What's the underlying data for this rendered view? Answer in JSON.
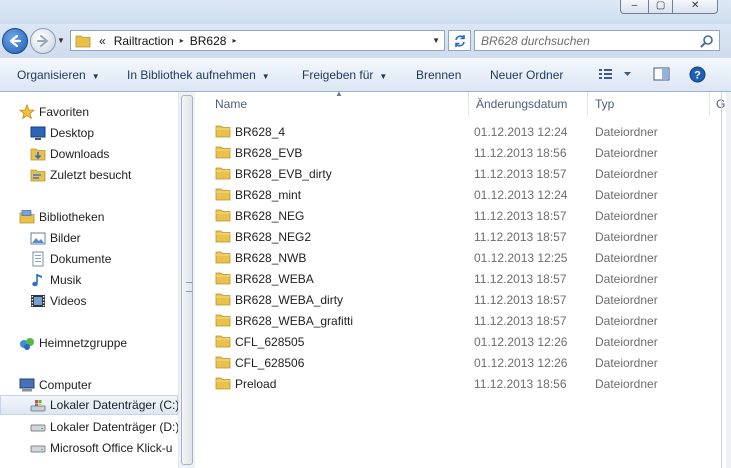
{
  "window": {
    "min_icon": "minimize-icon",
    "max_icon": "maximize-icon",
    "close_icon": "close-icon",
    "max_glyph": "▢",
    "close_glyph": "✕"
  },
  "address": {
    "prefix": "«",
    "crumbs": [
      "Railtraction",
      "BR628"
    ],
    "separator": "▸",
    "search_placeholder": "BR628 durchsuchen"
  },
  "toolbar": {
    "organize": "Organisieren",
    "library": "In Bibliothek aufnehmen",
    "share": "Freigeben für",
    "burn": "Brennen",
    "new_folder": "Neuer Ordner",
    "dropdown_arrow": "▼"
  },
  "nav": {
    "favorites": {
      "label": "Favoriten",
      "items": [
        "Desktop",
        "Downloads",
        "Zuletzt besucht"
      ]
    },
    "libraries": {
      "label": "Bibliotheken",
      "items": [
        "Bilder",
        "Dokumente",
        "Musik",
        "Videos"
      ]
    },
    "homegroup": {
      "label": "Heimnetzgruppe"
    },
    "computer": {
      "label": "Computer",
      "items": [
        "Lokaler Datenträger (C:)",
        "Lokaler Datenträger (D:)",
        "Microsoft Office Klick-u"
      ]
    }
  },
  "columns": {
    "name": "Name",
    "date": "Änderungsdatum",
    "type": "Typ",
    "extra": "G"
  },
  "files": [
    {
      "name": "BR628_4",
      "date": "01.12.2013 12:24",
      "type": "Dateiordner"
    },
    {
      "name": "BR628_EVB",
      "date": "11.12.2013 18:56",
      "type": "Dateiordner"
    },
    {
      "name": "BR628_EVB_dirty",
      "date": "11.12.2013 18:57",
      "type": "Dateiordner"
    },
    {
      "name": "BR628_mint",
      "date": "01.12.2013 12:24",
      "type": "Dateiordner"
    },
    {
      "name": "BR628_NEG",
      "date": "11.12.2013 18:57",
      "type": "Dateiordner"
    },
    {
      "name": "BR628_NEG2",
      "date": "11.12.2013 18:57",
      "type": "Dateiordner"
    },
    {
      "name": "BR628_NWB",
      "date": "01.12.2013 12:25",
      "type": "Dateiordner"
    },
    {
      "name": "BR628_WEBA",
      "date": "11.12.2013 18:57",
      "type": "Dateiordner"
    },
    {
      "name": "BR628_WEBA_dirty",
      "date": "11.12.2013 18:57",
      "type": "Dateiordner"
    },
    {
      "name": "BR628_WEBA_grafitti",
      "date": "11.12.2013 18:57",
      "type": "Dateiordner"
    },
    {
      "name": "CFL_628505",
      "date": "01.12.2013 12:26",
      "type": "Dateiordner"
    },
    {
      "name": "CFL_628506",
      "date": "01.12.2013 12:26",
      "type": "Dateiordner"
    },
    {
      "name": "Preload",
      "date": "11.12.2013 18:56",
      "type": "Dateiordner"
    }
  ]
}
